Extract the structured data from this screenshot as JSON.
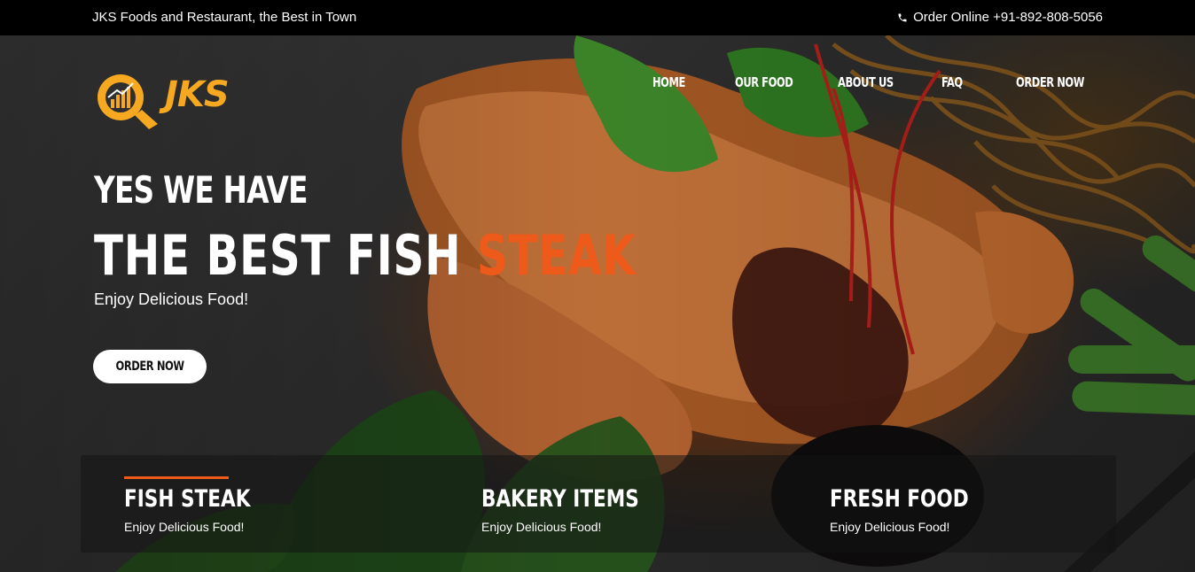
{
  "topbar": {
    "tagline": "JKS Foods and Restaurant, the Best in Town",
    "order_online": "Order Online +91-892-808-5056",
    "phone_icon": "phone-icon"
  },
  "logo": {
    "text": "JKS",
    "icon": "chart-magnifier-logo-icon"
  },
  "nav": [
    {
      "label": "HOME"
    },
    {
      "label": "OUR FOOD"
    },
    {
      "label": "ABOUT US"
    },
    {
      "label": "FAQ"
    },
    {
      "label": "ORDER NOW"
    }
  ],
  "hero": {
    "line1": "YES WE HAVE",
    "line2_main": "THE BEST FISH ",
    "line2_accent": "STEAK",
    "subtitle": "Enjoy Delicious Food!",
    "cta": "ORDER NOW"
  },
  "features": [
    {
      "title": "FISH STEAK",
      "desc": "Enjoy Delicious Food!"
    },
    {
      "title": "BAKERY ITEMS",
      "desc": "Enjoy Delicious Food!"
    },
    {
      "title": "FRESH FOOD",
      "desc": "Enjoy Delicious Food!"
    }
  ],
  "colors": {
    "accent": "#ee5a1a",
    "logo": "#f6a821",
    "topbar": "#000000"
  }
}
